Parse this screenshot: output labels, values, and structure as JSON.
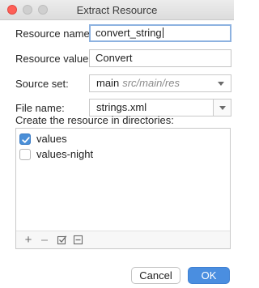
{
  "window": {
    "title": "Extract Resource"
  },
  "form": {
    "resource_name": {
      "label": "Resource name:",
      "value": "convert_string"
    },
    "resource_value": {
      "label": "Resource value:",
      "value": "Convert"
    },
    "source_set": {
      "label": "Source set:",
      "value": "main",
      "hint": "src/main/res"
    },
    "file_name": {
      "label": "File name:",
      "value": "strings.xml"
    }
  },
  "directories": {
    "label": "Create the resource in directories:",
    "items": [
      {
        "label": "values",
        "checked": true
      },
      {
        "label": "values-night",
        "checked": false
      }
    ],
    "toolbar": [
      "add-icon",
      "remove-icon",
      "select-all-icon",
      "collapse-icon"
    ]
  },
  "buttons": {
    "cancel": "Cancel",
    "ok": "OK"
  },
  "colors": {
    "primary_button": "#4a8ee0",
    "checkbox_checked": "#4a8fd8",
    "close_button": "#fe5f57"
  }
}
